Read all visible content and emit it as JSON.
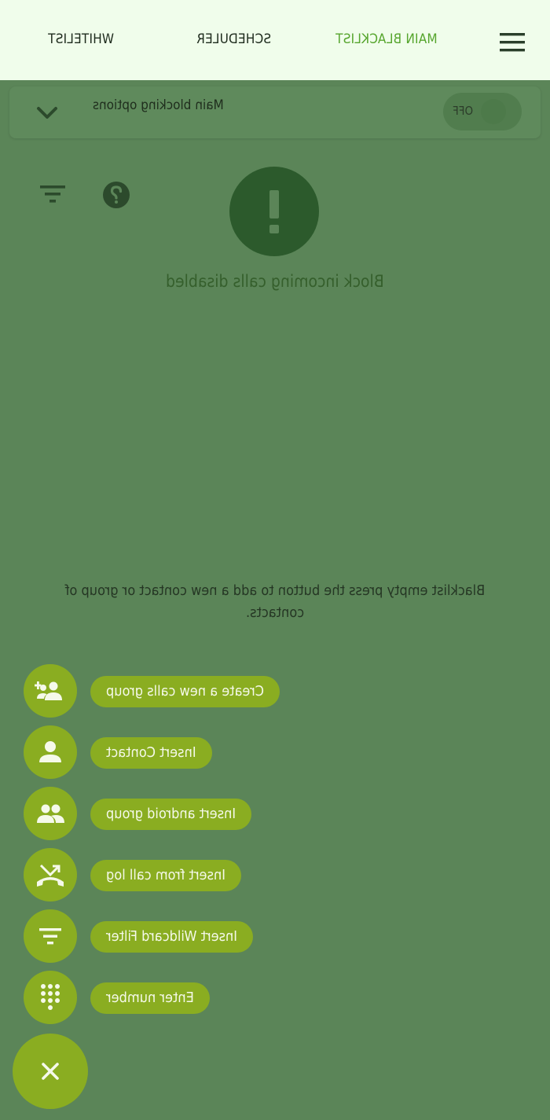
{
  "header": {
    "tabs": [
      {
        "label": "MAIN BLACKLIST",
        "active": true
      },
      {
        "label": "SCHEDULER",
        "active": false
      },
      {
        "label": "WHITELIST",
        "active": false
      }
    ],
    "menu_icon": "hamburger-menu-icon"
  },
  "options": {
    "label": "Main blocking options",
    "toggle_label": "OFF",
    "toggle_on": false,
    "expand_icon": "chevron-down-icon"
  },
  "status": {
    "icon": "exclamation-icon",
    "text": "Block incoming calls disabled"
  },
  "toolbar": {
    "help_icon": "help-icon",
    "filter_icon": "filter-icon"
  },
  "empty_message": "Blacklist empty press the button to add a new contact or group of contacts.",
  "fab_menu": {
    "items": [
      {
        "label": "Create a new calls group",
        "icon": "add-group-icon"
      },
      {
        "label": "Insert Contact",
        "icon": "person-icon"
      },
      {
        "label": "Insert android group",
        "icon": "people-icon"
      },
      {
        "label": "Insert from call log",
        "icon": "call-missed-icon"
      },
      {
        "label": "Insert Wildcard Filter",
        "icon": "filter-icon"
      },
      {
        "label": "Enter number",
        "icon": "dialpad-icon"
      }
    ],
    "close_icon": "close-icon"
  },
  "colors": {
    "background": "#5b8558",
    "topbar": "#f0fdeb",
    "accent": "#8aad21",
    "active_tab": "#56a52d",
    "alert": "#2c5a2c"
  }
}
